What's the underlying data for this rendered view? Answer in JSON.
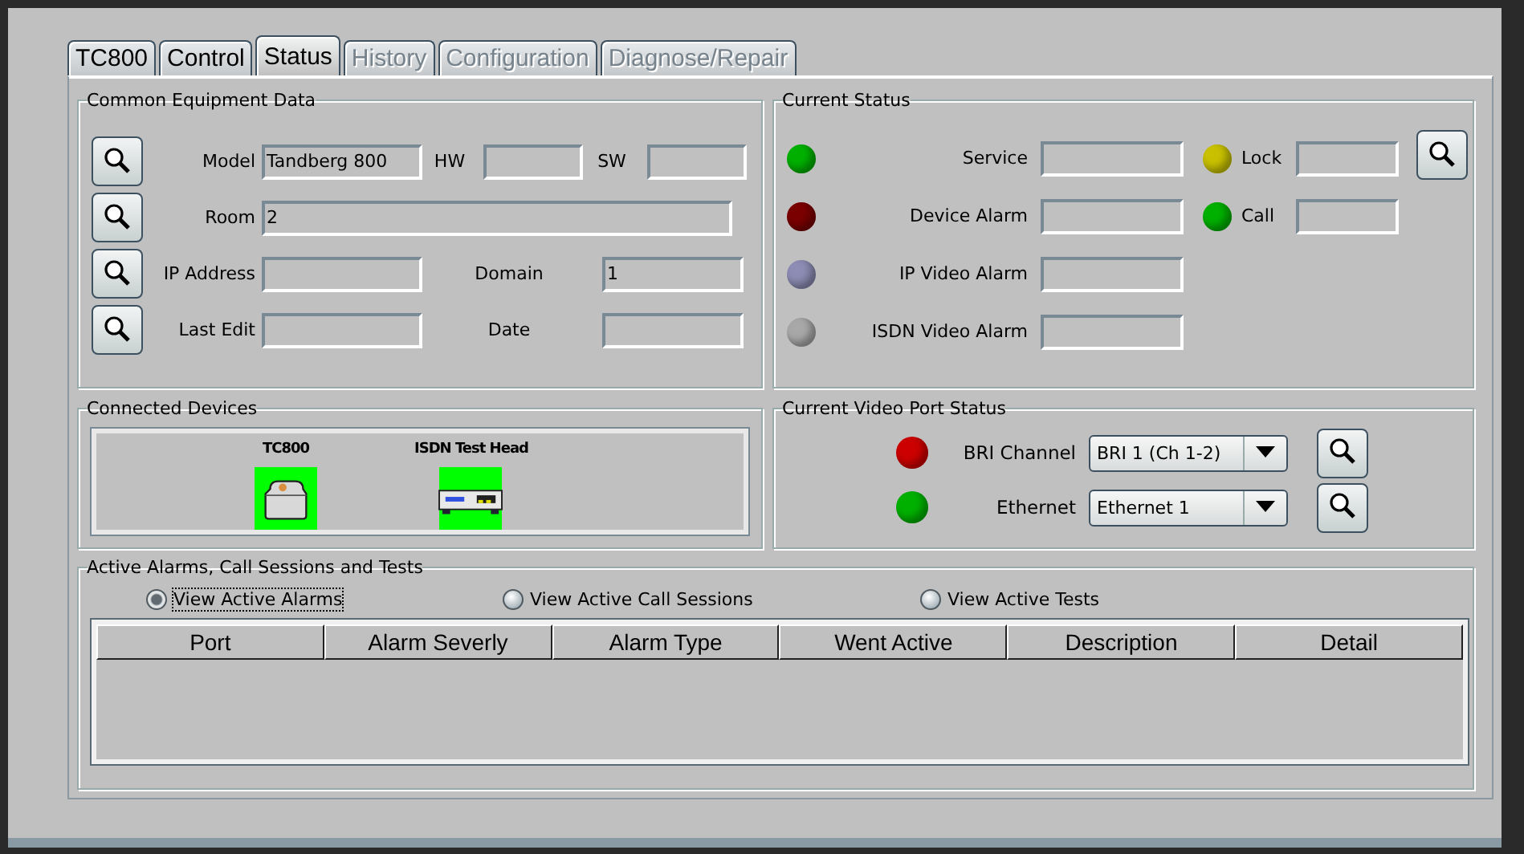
{
  "tabs": [
    {
      "label": "TC800",
      "selected": false,
      "disabled": false
    },
    {
      "label": "Control",
      "selected": false,
      "disabled": false
    },
    {
      "label": "Status",
      "selected": true,
      "disabled": false
    },
    {
      "label": "History",
      "selected": false,
      "disabled": true
    },
    {
      "label": "Configuration",
      "selected": false,
      "disabled": true
    },
    {
      "label": "Diagnose/Repair",
      "selected": false,
      "disabled": true
    }
  ],
  "equipment": {
    "title": "Common Equipment Data",
    "rows": [
      {
        "fields": [
          {
            "label": "Model",
            "value": "Tandberg 800"
          },
          {
            "label": "HW"
          },
          {
            "label": "SW"
          }
        ]
      },
      {
        "fields": [
          {
            "label": "Room",
            "value": "2"
          }
        ]
      },
      {
        "fields": [
          {
            "label": "IP Address"
          },
          {
            "label": "Domain",
            "value": "1"
          }
        ]
      },
      {
        "fields": [
          {
            "label": "Last Edit"
          },
          {
            "label": "Date"
          }
        ]
      }
    ]
  },
  "current_status": {
    "title": "Current Status",
    "left": [
      {
        "label": "Service",
        "color": "#00b000"
      },
      {
        "label": "Device Alarm",
        "color": "#7a0000"
      },
      {
        "label": "IP Video Alarm",
        "color": "#8c8cb4"
      },
      {
        "label": "ISDN Video Alarm",
        "color": "#a8a8a8"
      }
    ],
    "right": [
      {
        "label": "Lock",
        "color": "#c8c000"
      },
      {
        "label": "Call",
        "color": "#00b000"
      }
    ]
  },
  "connected_devices": {
    "title": "Connected Devices",
    "devices": [
      {
        "name": "TC800",
        "kind": "codec"
      },
      {
        "name": "ISDN Test Head",
        "kind": "rack-unit"
      }
    ]
  },
  "video_ports": {
    "title": "Current Video Port Status",
    "ports": [
      {
        "label": "BRI Channel",
        "color": "#cc0000",
        "value": "BRI 1 (Ch 1-2)"
      },
      {
        "label": "Ethernet",
        "color": "#00b000",
        "value": "Ethernet 1"
      }
    ]
  },
  "active": {
    "title": "Active Alarms, Call Sessions and Tests",
    "options": [
      {
        "label": "View Active Alarms",
        "selected": true
      },
      {
        "label": "View Active Call Sessions",
        "selected": false
      },
      {
        "label": "View Active Tests",
        "selected": false
      }
    ],
    "columns": [
      "Port",
      "Alarm Severly",
      "Alarm Type",
      "Went Active",
      "Description",
      "Detail"
    ]
  }
}
